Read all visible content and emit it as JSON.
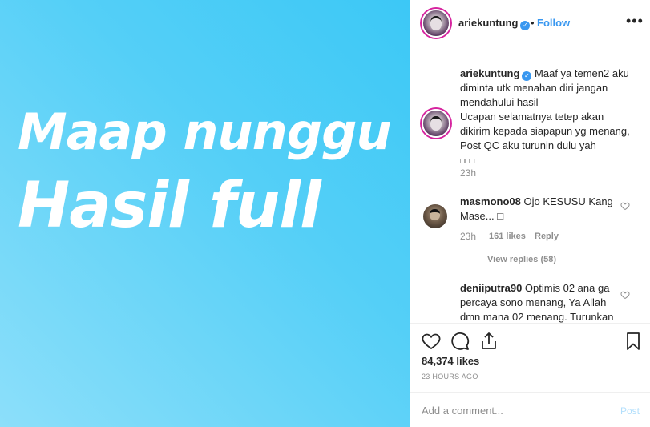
{
  "media": {
    "line1": "Maap nunggu",
    "line2": "Hasil full",
    "gradient_from": "#3cc8f6",
    "gradient_to": "#8cdffa"
  },
  "header": {
    "username": "ariekuntung",
    "verified_icon": "verified-badge-icon",
    "separator": "•",
    "follow_label": "Follow",
    "more_icon": "more-options-icon"
  },
  "caption": {
    "username": "ariekuntung",
    "text": "Maaf ya temen2 aku diminta utk menahan diri jangan mendahului hasil",
    "text2": "Ucapan selamatnya tetep akan dikirim kepada siapapun yg menang,",
    "text3": "Post QC aku turunin dulu yah",
    "emoji": "□□□",
    "time": "23h"
  },
  "comments": [
    {
      "username": "masmono08",
      "text": "Ojo KESUSU Kang Mase... □",
      "time": "23h",
      "likes": "161 likes",
      "reply_label": "Reply",
      "view_replies": "View replies (58)"
    },
    {
      "username": "deniiputra90",
      "text": "Optimis 02 ana ga percaya sono menang, Ya Allah dmn mana 02 menang. Turunkan"
    }
  ],
  "actions": {
    "like_icon": "heart-icon",
    "comment_icon": "comment-icon",
    "share_icon": "share-icon",
    "save_icon": "bookmark-icon"
  },
  "likes_count": "84,374 likes",
  "time_ago": "23 HOURS AGO",
  "add_comment": {
    "placeholder": "Add a comment...",
    "post_label": "Post"
  },
  "colors": {
    "link": "#3897f0",
    "muted": "#8e8e8e",
    "post_disabled": "#b2dffc"
  }
}
